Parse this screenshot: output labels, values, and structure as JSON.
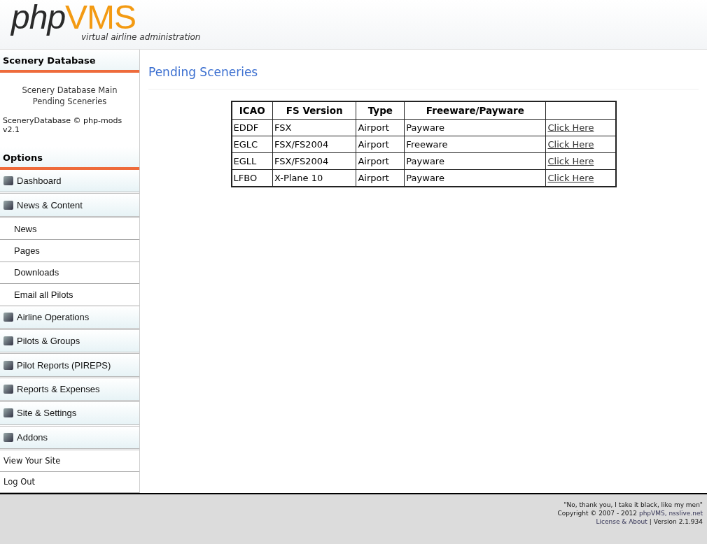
{
  "logo": {
    "prefix": "php",
    "suffix": "VMS",
    "tagline": "virtual airline administration"
  },
  "sidebar": {
    "module_title": "Scenery Database",
    "module_links": [
      "Scenery Database Main",
      "Pending Sceneries"
    ],
    "module_credit": "SceneryDatabase © php-mods v2.1",
    "options_title": "Options",
    "items": [
      {
        "kind": "section",
        "label": "Dashboard"
      },
      {
        "kind": "section",
        "label": "News & Content"
      },
      {
        "kind": "sub",
        "label": "News"
      },
      {
        "kind": "sub",
        "label": "Pages"
      },
      {
        "kind": "sub",
        "label": "Downloads"
      },
      {
        "kind": "sub",
        "label": "Email all Pilots"
      },
      {
        "kind": "section",
        "label": "Airline Operations"
      },
      {
        "kind": "section",
        "label": "Pilots & Groups"
      },
      {
        "kind": "section",
        "label": "Pilot Reports (PIREPS)"
      },
      {
        "kind": "section",
        "label": "Reports & Expenses"
      },
      {
        "kind": "section",
        "label": "Site & Settings"
      },
      {
        "kind": "section",
        "label": "Addons"
      },
      {
        "kind": "plain",
        "label": "View Your Site"
      },
      {
        "kind": "plain",
        "label": "Log Out"
      }
    ]
  },
  "page_title": "Pending Sceneries",
  "table": {
    "columns": [
      "ICAO",
      "FS Version",
      "Type",
      "Freeware/Payware"
    ],
    "rows": [
      {
        "cells": [
          "EDDF",
          "FSX",
          "Airport",
          "Payware"
        ],
        "link": "Click Here"
      },
      {
        "cells": [
          "EGLC",
          "FSX/FS2004",
          "Airport",
          "Freeware"
        ],
        "link": "Click Here"
      },
      {
        "cells": [
          "EGLL",
          "FSX/FS2004",
          "Airport",
          "Payware"
        ],
        "link": "Click Here"
      },
      {
        "cells": [
          "LFBO",
          "X-Plane 10",
          "Airport",
          "Payware"
        ],
        "link": "Click Here"
      }
    ]
  },
  "footer": {
    "quote": "\"No, thank you, I take it black, like my men\"",
    "copyright": "Copyright © 2007 - 2012",
    "copyright_link": "phpVMS, nsslive.net",
    "license_link": "License & About",
    "version": "| Version 2.1.934"
  }
}
